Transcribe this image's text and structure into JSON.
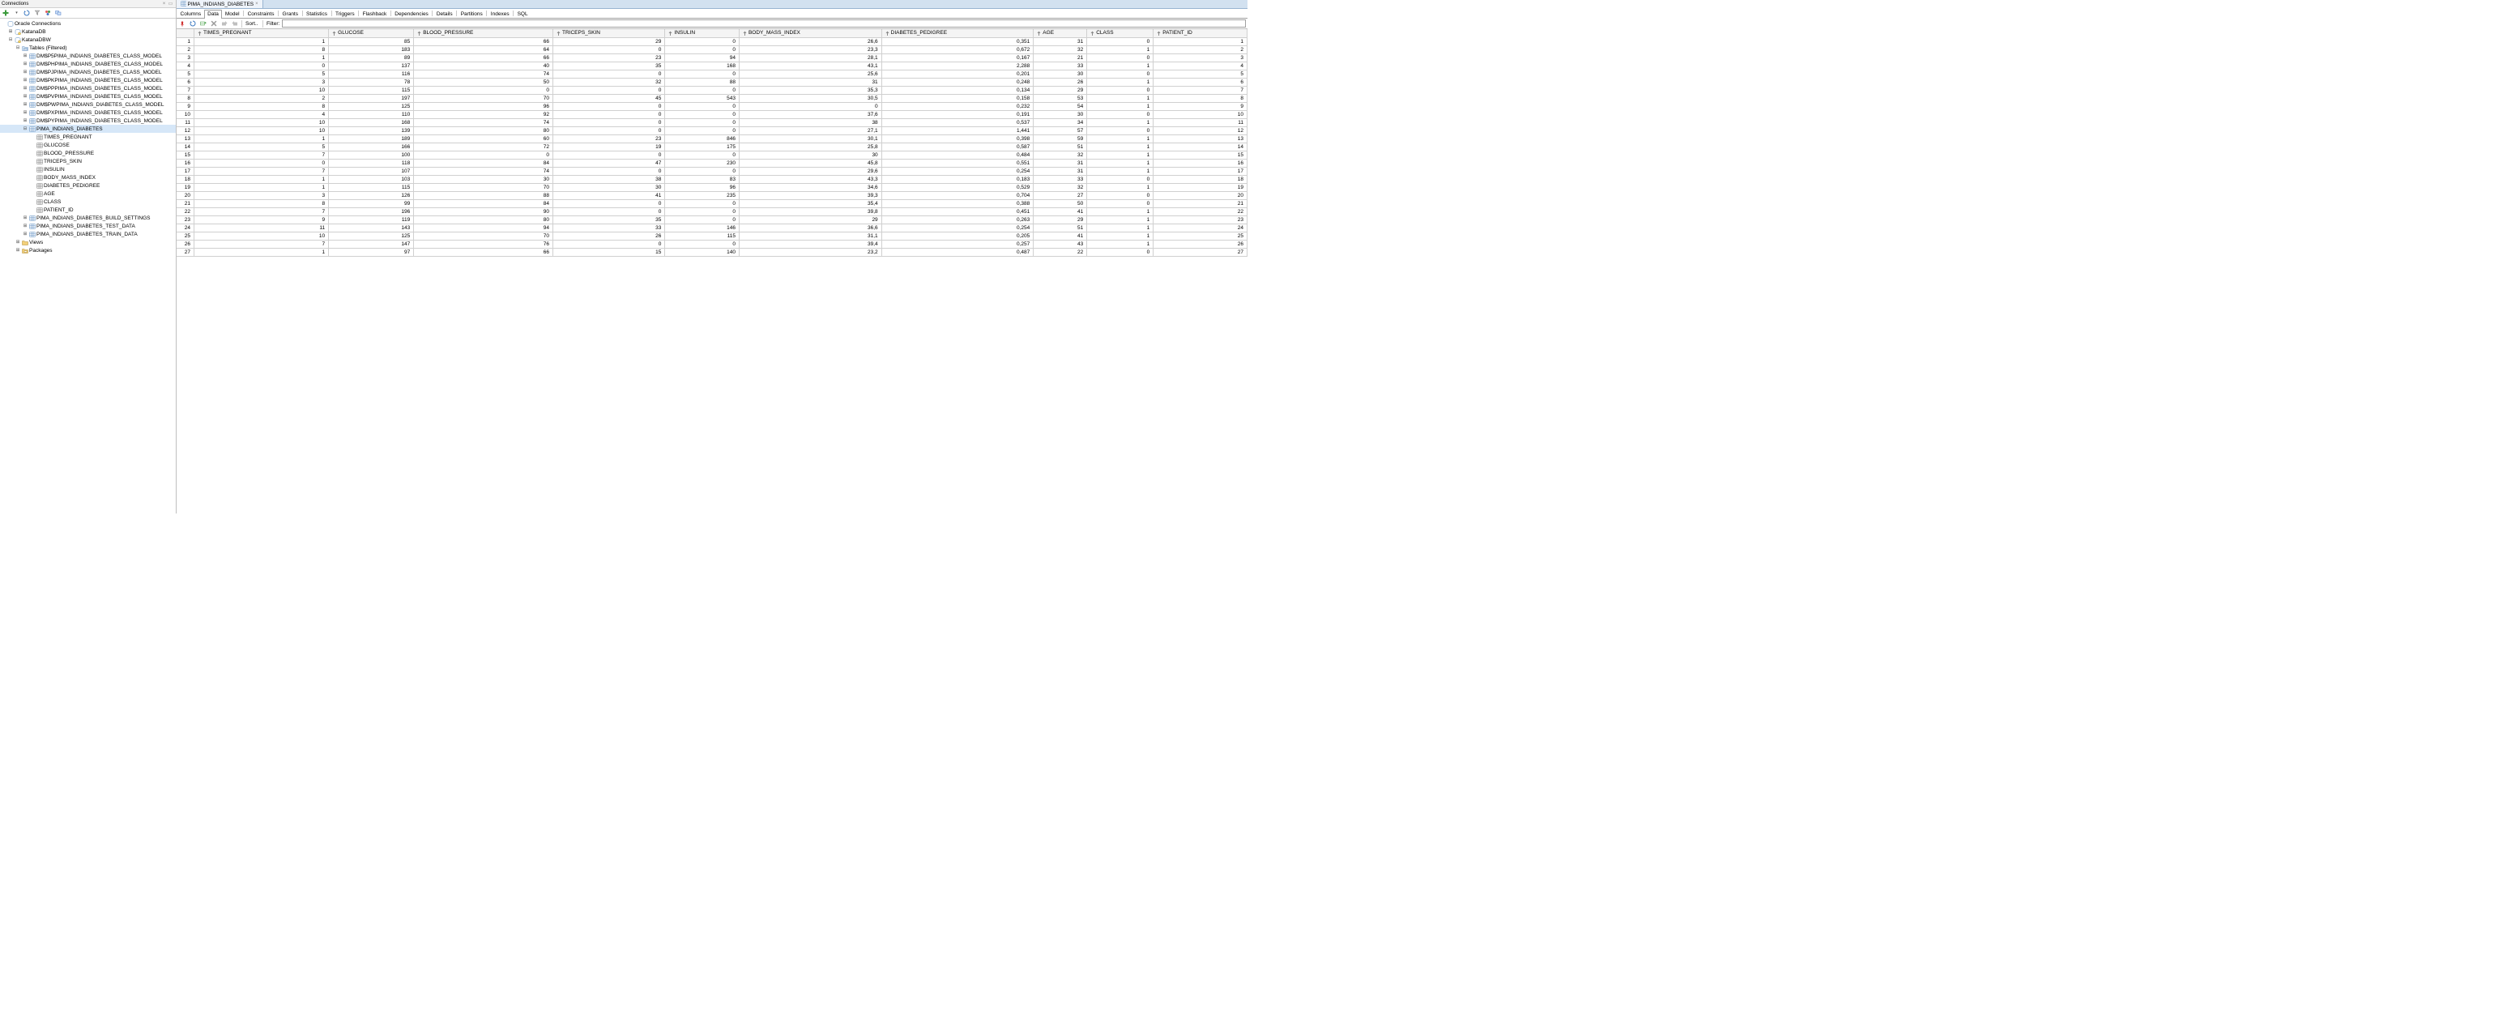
{
  "left_panel": {
    "title": "Connections",
    "root": "Oracle Connections",
    "connections": [
      {
        "name": "KatanaDB",
        "expanded": false
      },
      {
        "name": "KatanaDBW",
        "expanded": true,
        "children": [
          {
            "name": "Tables (Filtered)",
            "type": "tablesFolder",
            "expanded": true,
            "children": [
              {
                "name": "DM$P5PIMA_INDIANS_DIABETES_CLASS_MODEL",
                "type": "table"
              },
              {
                "name": "DM$PHPIMA_INDIANS_DIABETES_CLASS_MODEL",
                "type": "table"
              },
              {
                "name": "DM$PJPIMA_INDIANS_DIABETES_CLASS_MODEL",
                "type": "table"
              },
              {
                "name": "DM$PKPIMA_INDIANS_DIABETES_CLASS_MODEL",
                "type": "table"
              },
              {
                "name": "DM$PPPIMA_INDIANS_DIABETES_CLASS_MODEL",
                "type": "table"
              },
              {
                "name": "DM$PVPIMA_INDIANS_DIABETES_CLASS_MODEL",
                "type": "table"
              },
              {
                "name": "DM$PWPIMA_INDIANS_DIABETES_CLASS_MODEL",
                "type": "table"
              },
              {
                "name": "DM$PXPIMA_INDIANS_DIABETES_CLASS_MODEL",
                "type": "table"
              },
              {
                "name": "DM$PYPIMA_INDIANS_DIABETES_CLASS_MODEL",
                "type": "table"
              },
              {
                "name": "PIMA_INDIANS_DIABETES",
                "type": "table",
                "selected": true,
                "expanded": true,
                "columns": [
                  "TIMES_PREGNANT",
                  "GLUCOSE",
                  "BLOOD_PRESSURE",
                  "TRICEPS_SKIN",
                  "INSULIN",
                  "BODY_MASS_INDEX",
                  "DIABETES_PEDIGREE",
                  "AGE",
                  "CLASS",
                  "PATIENT_ID"
                ]
              },
              {
                "name": "PIMA_INDIANS_DIABETES_BUILD_SETTINGS",
                "type": "table"
              },
              {
                "name": "PIMA_INDIANS_DIABETES_TEST_DATA",
                "type": "table"
              },
              {
                "name": "PIMA_INDIANS_DIABETES_TRAIN_DATA",
                "type": "table"
              }
            ]
          },
          {
            "name": "Views",
            "type": "folder"
          },
          {
            "name": "Packages",
            "type": "pkgFolder"
          }
        ]
      }
    ]
  },
  "editor": {
    "tab_title": "PIMA_INDIANS_DIABETES",
    "sub_tabs": [
      "Columns",
      "Data",
      "Model",
      "Constraints",
      "Grants",
      "Statistics",
      "Triggers",
      "Flashback",
      "Dependencies",
      "Details",
      "Partitions",
      "Indexes",
      "SQL"
    ],
    "active_sub_tab": 1,
    "sort_label": "Sort..",
    "filter_label": "Filter:",
    "filter_value": ""
  },
  "grid": {
    "columns": [
      "TIMES_PREGNANT",
      "GLUCOSE",
      "BLOOD_PRESSURE",
      "TRICEPS_SKIN",
      "INSULIN",
      "BODY_MASS_INDEX",
      "DIABETES_PEDIGREE",
      "AGE",
      "CLASS",
      "PATIENT_ID"
    ],
    "rows": [
      [
        "1",
        "85",
        "66",
        "29",
        "0",
        "26,6",
        "0,351",
        "31",
        "0",
        "1"
      ],
      [
        "8",
        "183",
        "64",
        "0",
        "0",
        "23,3",
        "0,672",
        "32",
        "1",
        "2"
      ],
      [
        "1",
        "89",
        "66",
        "23",
        "94",
        "28,1",
        "0,167",
        "21",
        "0",
        "3"
      ],
      [
        "0",
        "137",
        "40",
        "35",
        "168",
        "43,1",
        "2,288",
        "33",
        "1",
        "4"
      ],
      [
        "5",
        "116",
        "74",
        "0",
        "0",
        "25,6",
        "0,201",
        "30",
        "0",
        "5"
      ],
      [
        "3",
        "78",
        "50",
        "32",
        "88",
        "31",
        "0,248",
        "26",
        "1",
        "6"
      ],
      [
        "10",
        "115",
        "0",
        "0",
        "0",
        "35,3",
        "0,134",
        "29",
        "0",
        "7"
      ],
      [
        "2",
        "197",
        "70",
        "45",
        "543",
        "30,5",
        "0,158",
        "53",
        "1",
        "8"
      ],
      [
        "8",
        "125",
        "96",
        "0",
        "0",
        "0",
        "0,232",
        "54",
        "1",
        "9"
      ],
      [
        "4",
        "110",
        "92",
        "0",
        "0",
        "37,6",
        "0,191",
        "30",
        "0",
        "10"
      ],
      [
        "10",
        "168",
        "74",
        "0",
        "0",
        "38",
        "0,537",
        "34",
        "1",
        "11"
      ],
      [
        "10",
        "139",
        "80",
        "0",
        "0",
        "27,1",
        "1,441",
        "57",
        "0",
        "12"
      ],
      [
        "1",
        "189",
        "60",
        "23",
        "846",
        "30,1",
        "0,398",
        "59",
        "1",
        "13"
      ],
      [
        "5",
        "166",
        "72",
        "19",
        "175",
        "25,8",
        "0,587",
        "51",
        "1",
        "14"
      ],
      [
        "7",
        "100",
        "0",
        "0",
        "0",
        "30",
        "0,484",
        "32",
        "1",
        "15"
      ],
      [
        "0",
        "118",
        "84",
        "47",
        "230",
        "45,8",
        "0,551",
        "31",
        "1",
        "16"
      ],
      [
        "7",
        "107",
        "74",
        "0",
        "0",
        "29,6",
        "0,254",
        "31",
        "1",
        "17"
      ],
      [
        "1",
        "103",
        "30",
        "38",
        "83",
        "43,3",
        "0,183",
        "33",
        "0",
        "18"
      ],
      [
        "1",
        "115",
        "70",
        "30",
        "96",
        "34,6",
        "0,529",
        "32",
        "1",
        "19"
      ],
      [
        "3",
        "126",
        "88",
        "41",
        "235",
        "39,3",
        "0,704",
        "27",
        "0",
        "20"
      ],
      [
        "8",
        "99",
        "84",
        "0",
        "0",
        "35,4",
        "0,388",
        "50",
        "0",
        "21"
      ],
      [
        "7",
        "196",
        "90",
        "0",
        "0",
        "39,8",
        "0,451",
        "41",
        "1",
        "22"
      ],
      [
        "9",
        "119",
        "80",
        "35",
        "0",
        "29",
        "0,263",
        "29",
        "1",
        "23"
      ],
      [
        "11",
        "143",
        "94",
        "33",
        "146",
        "36,6",
        "0,254",
        "51",
        "1",
        "24"
      ],
      [
        "10",
        "125",
        "70",
        "26",
        "115",
        "31,1",
        "0,205",
        "41",
        "1",
        "25"
      ],
      [
        "7",
        "147",
        "76",
        "0",
        "0",
        "39,4",
        "0,257",
        "43",
        "1",
        "26"
      ],
      [
        "1",
        "97",
        "66",
        "15",
        "140",
        "23,2",
        "0,487",
        "22",
        "0",
        "27"
      ]
    ]
  }
}
